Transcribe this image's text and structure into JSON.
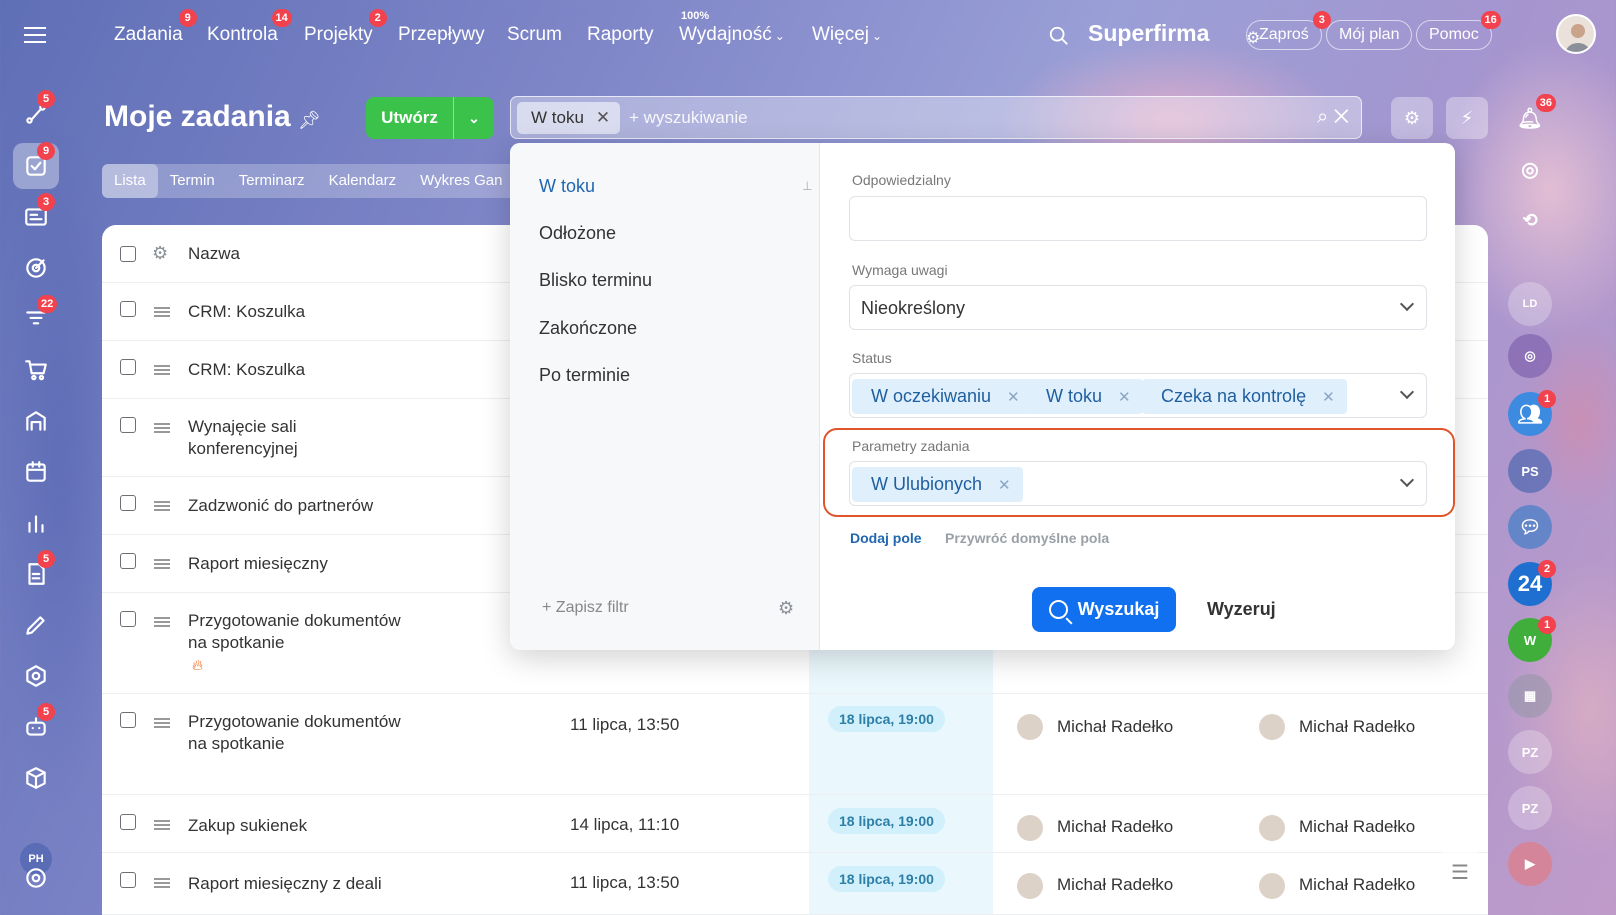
{
  "nav": {
    "items": [
      {
        "label": "Zadania",
        "badge": "9"
      },
      {
        "label": "Kontrola",
        "badge": "14"
      },
      {
        "label": "Projekty",
        "badge": "2"
      },
      {
        "label": "Przepływy",
        "badge": ""
      },
      {
        "label": "Scrum",
        "badge": ""
      },
      {
        "label": "Raporty",
        "badge": ""
      },
      {
        "label": "Wydajność",
        "badge": "",
        "top": "100%"
      },
      {
        "label": "Więcej",
        "badge": ""
      }
    ],
    "brand": "Superfirma",
    "invite": "Zaproś",
    "invite_badge": "3",
    "myplan": "Mój plan",
    "help": "Pomoc",
    "help_badge": "16"
  },
  "sidebar": {
    "badges": [
      "5",
      "9",
      "3",
      "22",
      "5",
      "5"
    ],
    "initials": "PH"
  },
  "header": {
    "title": "Moje zadania",
    "create": "Utwórz"
  },
  "search": {
    "chip": "W toku",
    "placeholder": "+ wyszukiwanie"
  },
  "tabs": [
    "Lista",
    "Termin",
    "Terminarz",
    "Kalendarz",
    "Wykres Gan"
  ],
  "table": {
    "header_name": "Nazwa",
    "rows": [
      {
        "name": "CRM: Koszulka"
      },
      {
        "name": "CRM: Koszulka"
      },
      {
        "name": "Wynajęcie sali konferencyjnej"
      },
      {
        "name": "Zadzwonić do partnerów"
      },
      {
        "name": "Raport miesięczny"
      },
      {
        "name": "Przygotowanie dokumentów na spotkanie"
      },
      {
        "name": "Przygotowanie dokumentów na spotkanie",
        "date": "11 lipca, 13:50",
        "deadline": "18 lipca, 19:00",
        "creator": "Michał Radełko",
        "responsible": "Michał Radełko"
      },
      {
        "name": "Zakup sukienek",
        "date": "14 lipca, 11:10",
        "deadline": "18 lipca, 19:00",
        "creator": "Michał Radełko",
        "responsible": "Michał Radełko"
      },
      {
        "name": "Raport miesięczny z deali",
        "date": "11 lipca, 13:50",
        "deadline": "18 lipca, 19:00",
        "creator": "Michał Radełko",
        "responsible": "Michał Radełko"
      }
    ]
  },
  "right_sidebar": {
    "bell_badge": "36",
    "badge1": "1",
    "ps": "PS",
    "badge24": "2",
    "label24": "24",
    "w": "W",
    "wbadge": "1",
    "pz": "PZ",
    "ld": "LD"
  },
  "filter": {
    "presets": [
      "W toku",
      "Odłożone",
      "Blisko terminu",
      "Zakończone",
      "Po terminie"
    ],
    "save": "Zapisz filtr",
    "responsible_label": "Odpowiedzialny",
    "attention_label": "Wymaga uwagi",
    "attention_value": "Nieokreślony",
    "status_label": "Status",
    "status_chips": [
      "W oczekiwaniu",
      "W toku",
      "Czeka na kontrolę"
    ],
    "params_label": "Parametry zadania",
    "params_chip": "W Ulubionych",
    "add_field": "Dodaj pole",
    "reset_fields": "Przywróć domyślne pola",
    "search_btn": "Wyszukaj",
    "reset_btn": "Wyzeruj"
  },
  "colors": {
    "accent": "#1070f0",
    "create": "#3bc24a",
    "highlight": "#e1542a",
    "badge": "#f2424d"
  }
}
